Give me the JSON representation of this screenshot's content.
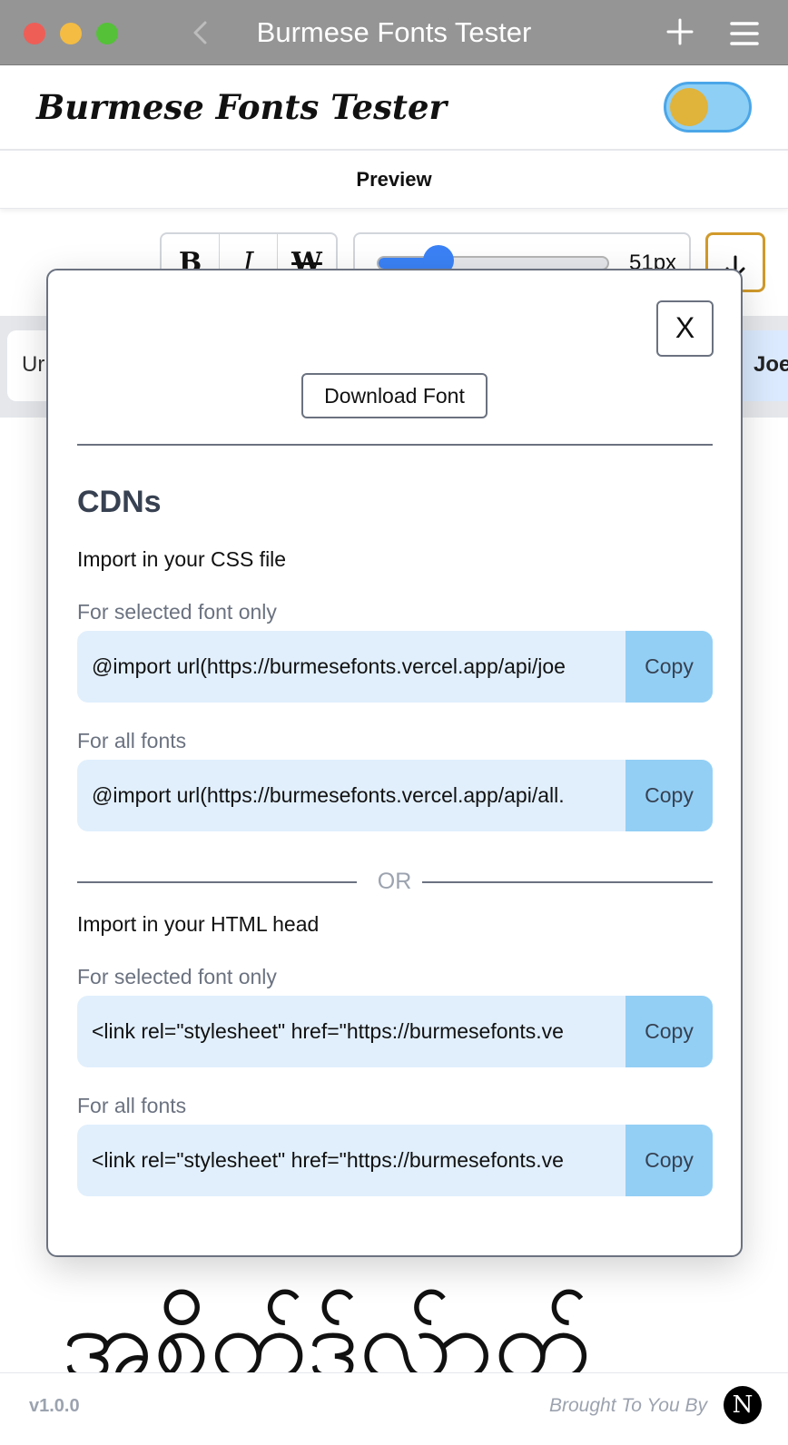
{
  "window": {
    "title": "Burmese Fonts Tester"
  },
  "header": {
    "title": "Burmese Fonts Tester"
  },
  "tabs": {
    "active": "Preview"
  },
  "toolbar": {
    "bold_label": "B",
    "italic_label": "I",
    "strike_label": "W",
    "font_size": "51px",
    "font_size_fraction": 0.25
  },
  "font_list": {
    "left_partial": "Ur",
    "selected_partial": "Joe"
  },
  "preview": {
    "sample": "အစိတ်ဒ်လ်ာတ်"
  },
  "modal": {
    "close_label": "X",
    "download_label": "Download Font",
    "cdn_title": "CDNs",
    "css_section": "Import in your CSS file",
    "html_section": "Import in your HTML head",
    "or_label": "OR",
    "rows": [
      {
        "label": "For selected font only",
        "code": "@import url(https://burmesefonts.vercel.app/api/joe",
        "copy": "Copy"
      },
      {
        "label": "For all fonts",
        "code": "@import url(https://burmesefonts.vercel.app/api/all.",
        "copy": "Copy"
      },
      {
        "label": "For selected font only",
        "code": "<link rel=\"stylesheet\" href=\"https://burmesefonts.ve",
        "copy": "Copy"
      },
      {
        "label": "For all fonts",
        "code": "<link rel=\"stylesheet\" href=\"https://burmesefonts.ve",
        "copy": "Copy"
      }
    ]
  },
  "footer": {
    "version": "v1.0.0",
    "credit": "Brought To You By",
    "logo_letter": "N"
  },
  "colors": {
    "accent": "#3b82f6",
    "code_bg": "#e1effc",
    "copy_bg": "#93cff5",
    "toggle_knob": "#e0b33b"
  }
}
